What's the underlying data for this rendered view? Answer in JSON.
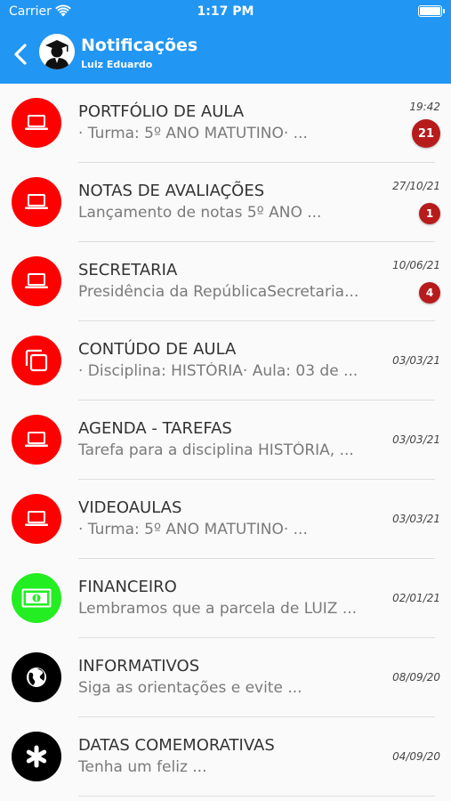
{
  "status_bar": {
    "carrier": "Carrier",
    "time": "1:17 PM"
  },
  "header": {
    "title": "Notificações",
    "subtitle": "Luiz Eduardo"
  },
  "colors": {
    "header": "#2196f3",
    "red": "#ff0000",
    "green": "#22ee22",
    "black": "#000000",
    "badge": "#b71c1c"
  },
  "notifications": [
    {
      "title": "PORTFÓLIO DE AULA",
      "preview": "· Turma: 5º ANO MATUTINO· ...",
      "time": "19:42",
      "badge": "21",
      "icon": "laptop-icon"
    },
    {
      "title": "NOTAS DE AVALIAÇÕES",
      "preview": "Lançamento de notas 5º ANO ...",
      "time": "27/10/21",
      "badge": "1",
      "icon": "laptop-icon"
    },
    {
      "title": "SECRETARIA",
      "preview": "Presidência da RepúblicaSecretaria...",
      "time": "10/06/21",
      "badge": "4",
      "icon": "laptop-icon"
    },
    {
      "title": "CONTÚDO DE AULA",
      "preview": "· Disciplina: HISTÓRIA· Aula: 03 de ...",
      "time": "03/03/21",
      "icon": "copy-icon"
    },
    {
      "title": "AGENDA - TAREFAS",
      "preview": "Tarefa para a disciplina HISTÓRIA, ...",
      "time": "03/03/21",
      "icon": "laptop-icon"
    },
    {
      "title": "VIDEOAULAS",
      "preview": "· Turma: 5º ANO MATUTINO· ...",
      "time": "03/03/21",
      "icon": "laptop-icon"
    },
    {
      "title": "FINANCEIRO",
      "preview": "Lembramos que a parcela de LUIZ ...",
      "time": "02/01/21",
      "icon": "money-icon"
    },
    {
      "title": "INFORMATIVOS",
      "preview": "Siga as orientações e evite ...",
      "time": "08/09/20",
      "icon": "globe-icon"
    },
    {
      "title": "DATAS COMEMORATIVAS",
      "preview": "Tenha um feliz ...",
      "time": "04/09/20",
      "icon": "asterisk-icon"
    }
  ]
}
